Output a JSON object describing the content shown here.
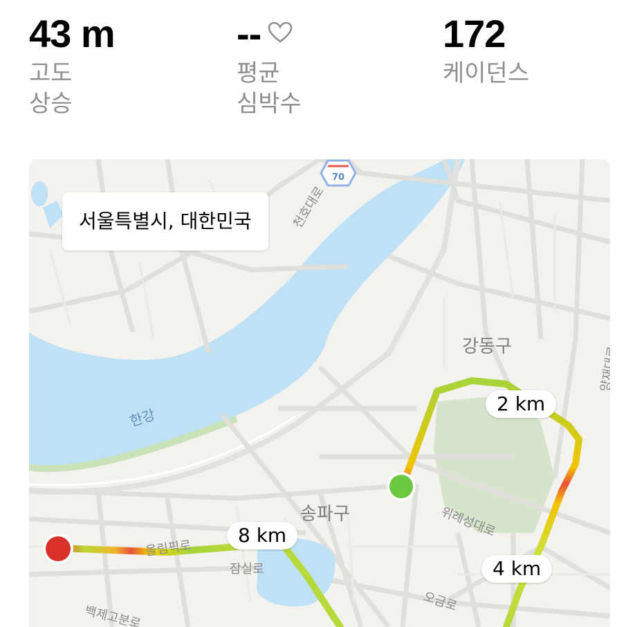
{
  "stats": [
    {
      "value": "43 m",
      "label1": "고도",
      "label2": "상승"
    },
    {
      "value": "--",
      "label1": "평균",
      "label2": "심박수",
      "icon": "heart-outline-icon"
    },
    {
      "value": "172",
      "label1": "케이던스",
      "label2": ""
    }
  ],
  "map": {
    "location": "서울특별시, 대한민국",
    "highway_shield": "70",
    "districts": [
      "강동구",
      "송파구"
    ],
    "river": "한강",
    "roads": [
      "올림픽로",
      "잠실로",
      "위례성대로",
      "오금로",
      "백제고분로",
      "천호대로",
      "양재대로"
    ],
    "distance_markers": [
      "2 km",
      "4 km",
      "8 km"
    ],
    "colors": {
      "route_slow": "#d9302a",
      "route_mid": "#f2d200",
      "route_fast": "#9fd334",
      "start": "#6cc83f",
      "end": "#d9302a",
      "water": "#bfe1f5"
    }
  }
}
